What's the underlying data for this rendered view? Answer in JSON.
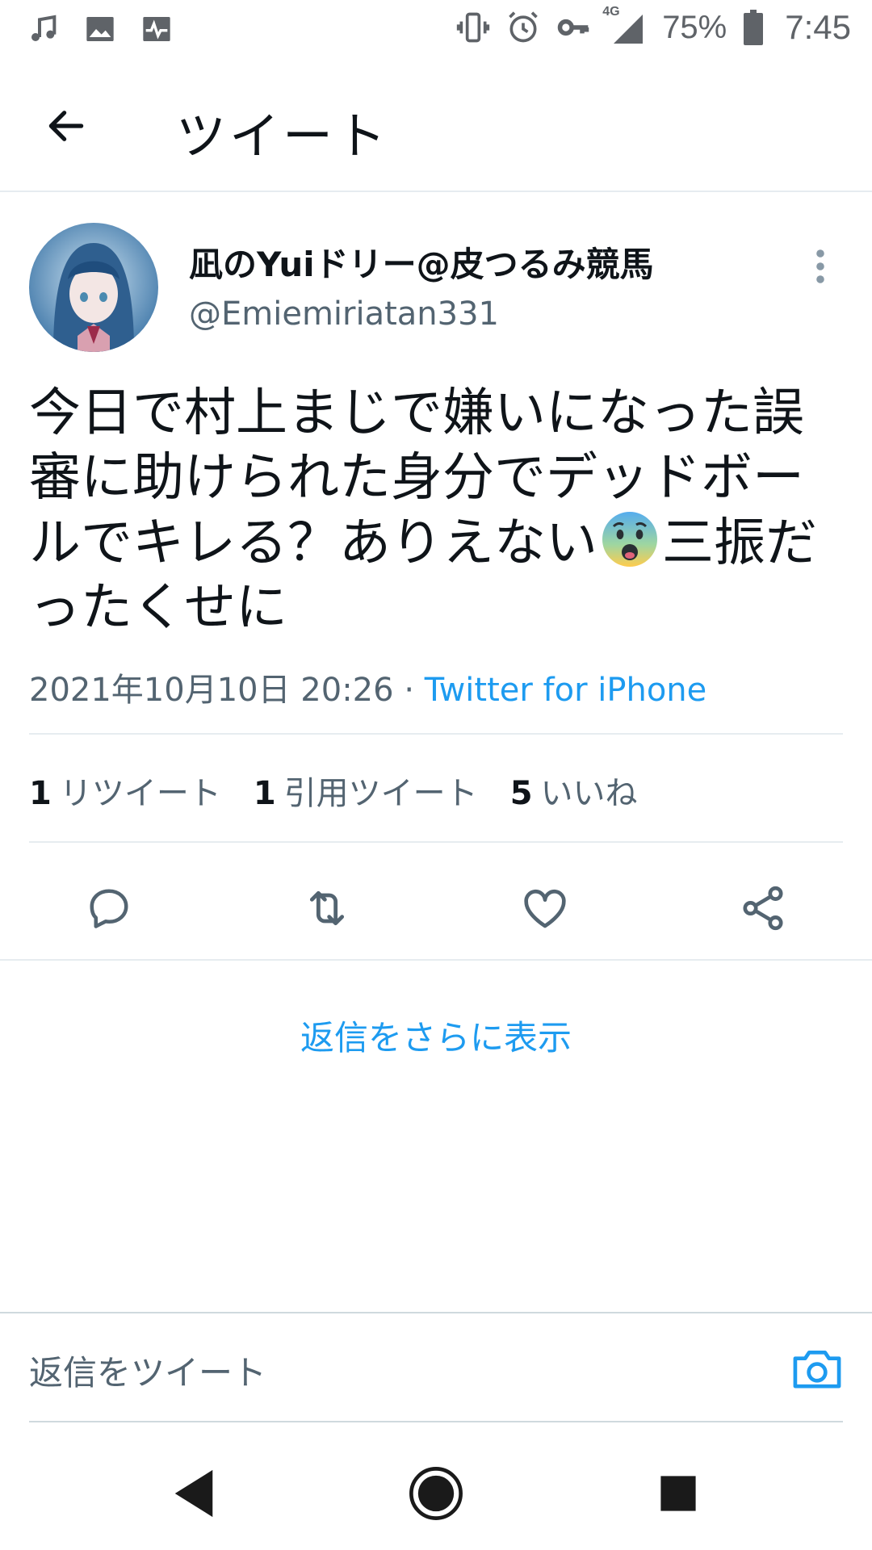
{
  "status_bar": {
    "left_icons": [
      "music-note-icon",
      "image-icon",
      "activity-icon"
    ],
    "right_icons": [
      "vibrate-icon",
      "alarm-icon",
      "vpn-key-icon",
      "signal-4g-icon",
      "battery-icon"
    ],
    "network_label": "4G",
    "battery_percent": "75%",
    "time": "7:45"
  },
  "app_bar": {
    "back_icon": "arrow-left-icon",
    "title": "ツイート"
  },
  "tweet": {
    "user": {
      "display_name": "凪のYuiドリー@皮つるみ競馬",
      "handle": "@Emiemiriatan331"
    },
    "more_icon": "more-vertical-icon",
    "text_part1": "今日で村上まじで嫌いになった誤審に助けられた身分でデッドボールでキレる？ありえない",
    "emoji": "anxious-face-emoji",
    "text_part2": "三振だったくせに",
    "timestamp": "2021年10月10日 20:26",
    "separator": "·",
    "source": "Twitter for iPhone"
  },
  "stats": {
    "retweets": {
      "count": "1",
      "label": "リツイート"
    },
    "quotes": {
      "count": "1",
      "label": "引用ツイート"
    },
    "likes": {
      "count": "5",
      "label": "いいね"
    }
  },
  "actions": [
    "reply-icon",
    "retweet-icon",
    "like-icon",
    "share-icon"
  ],
  "more_replies_label": "返信をさらに表示",
  "reply_bar": {
    "placeholder": "返信をツイート",
    "camera_icon": "camera-icon"
  },
  "nav_bar": [
    "nav-back-icon",
    "nav-home-icon",
    "nav-recents-icon"
  ],
  "colors": {
    "accent": "#1d9bf0",
    "text_primary": "#0f1419",
    "text_secondary": "#536471",
    "divider": "#e6ecf0"
  }
}
